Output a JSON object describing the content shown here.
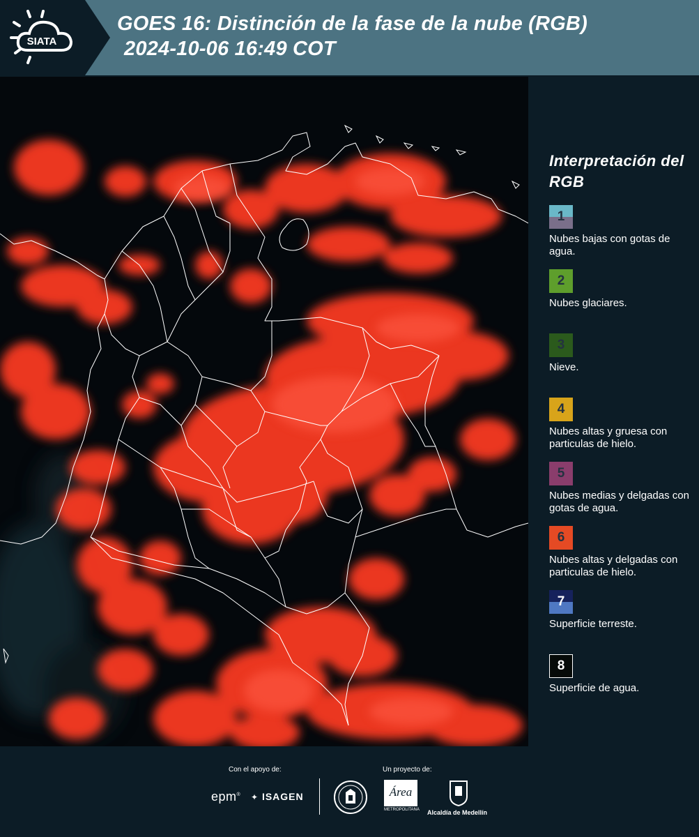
{
  "header": {
    "logo_text": "SIATA",
    "title_line1": "GOES 16: Distinción de la fase de la nube (RGB)",
    "title_line2": "2024-10-06 16:49 COT"
  },
  "map": {
    "background_color": "#04080c",
    "cloud_color": "#ff3a24",
    "border_color": "#ffffff"
  },
  "legend": {
    "title": "Interpretación del RGB",
    "items": [
      {
        "number": "1",
        "label": "Nubes bajas con gotas de agua.",
        "colors": [
          "#6ab8c8",
          "#7a6f8a"
        ]
      },
      {
        "number": "2",
        "label": "Nubes glaciares.",
        "colors": [
          "#5e9e2c"
        ]
      },
      {
        "number": "3",
        "label": "Nieve.",
        "colors": [
          "#2b5a1c"
        ]
      },
      {
        "number": "4",
        "label": "Nubes altas y gruesa con particulas de hielo.",
        "colors": [
          "#d8a41a"
        ]
      },
      {
        "number": "5",
        "label": "Nubes medias y delgadas con gotas de agua.",
        "colors": [
          "#8a3d6c"
        ]
      },
      {
        "number": "6",
        "label": "Nubes altas y delgadas con particulas de hielo.",
        "colors": [
          "#e54a24"
        ]
      },
      {
        "number": "7",
        "label": "Superficie terreste.",
        "colors": [
          "#16225c",
          "#4f78c2"
        ]
      },
      {
        "number": "8",
        "label": "Superficie de agua.",
        "colors": [
          "#060a08"
        ]
      }
    ]
  },
  "footer": {
    "support_label": "Con el apoyo de:",
    "project_label": "Un proyecto de:",
    "sponsor_epm": "epm",
    "sponsor_isagen": "ISAGEN",
    "partner_area": "Área",
    "partner_area_sub": "METROPOLITANA",
    "partner_alcaldia": "Alcaldía de Medellín"
  }
}
